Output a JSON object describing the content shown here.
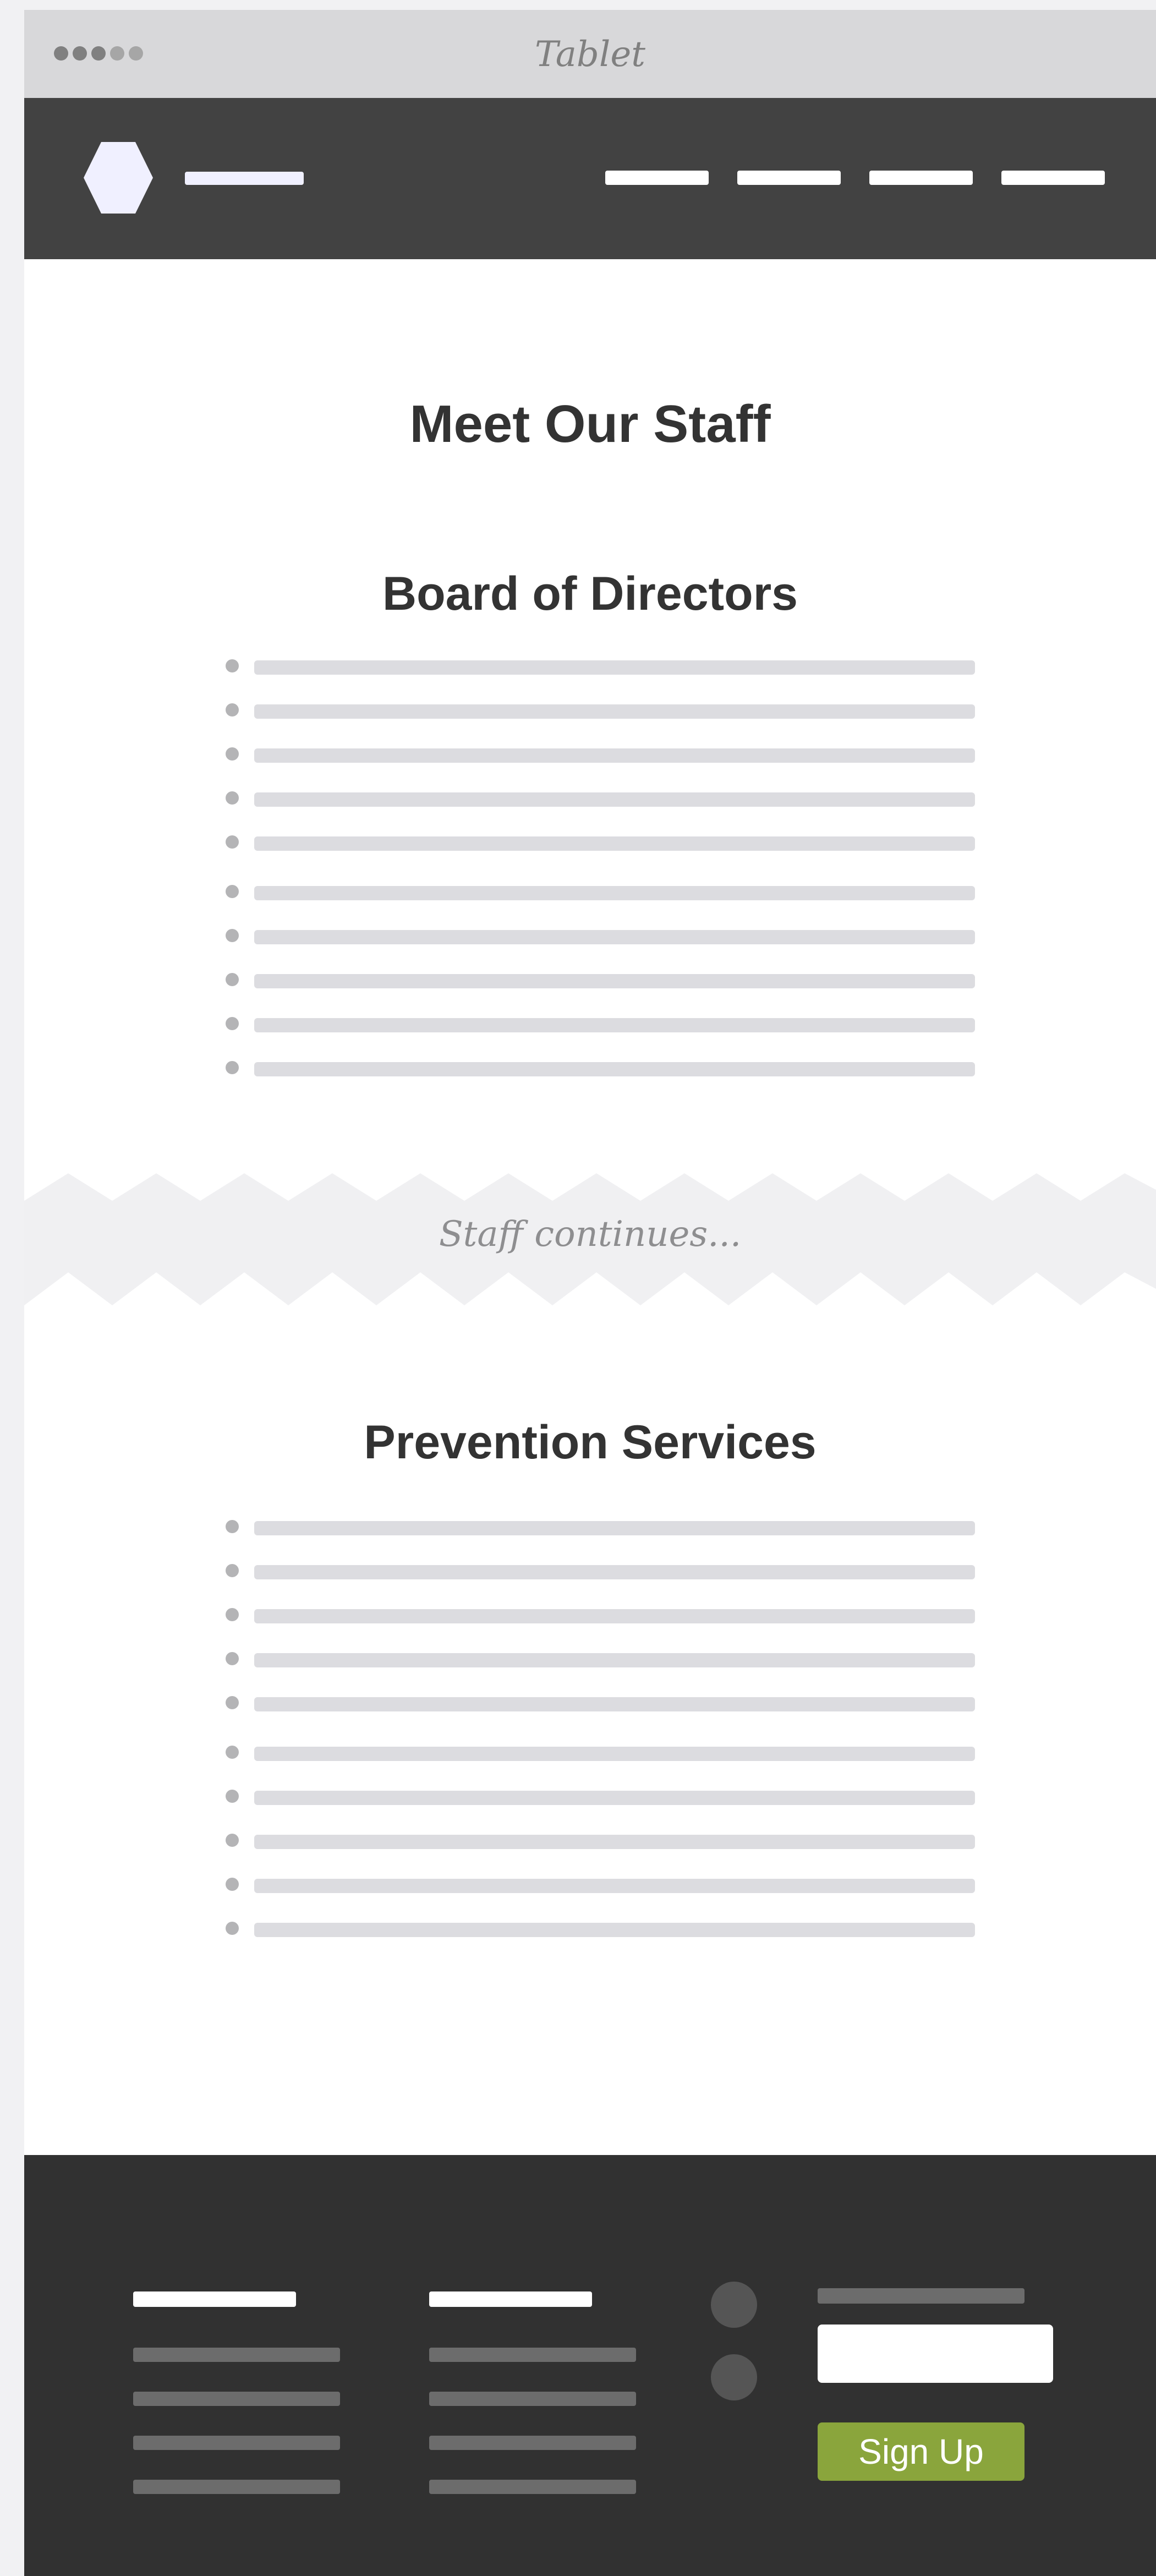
{
  "window": {
    "title": "Tablet",
    "signal_dots": [
      "#808080",
      "#808080",
      "#808080",
      "#a6a6a6",
      "#a6a6a6"
    ]
  },
  "nav": {
    "logo_icon": "hexagon-logo-icon",
    "items_count_shown": 4
  },
  "main": {
    "page_title": "Meet Our Staff",
    "sections": [
      {
        "title": "Board of Directors",
        "placeholder_rows": 10
      },
      {
        "title": "Prevention Services",
        "placeholder_rows": 10
      }
    ],
    "break_label": "Staff continues..."
  },
  "footer": {
    "signup_label": "Sign Up",
    "email_placeholder": "",
    "social_icons": [
      "social-icon",
      "social-icon"
    ]
  },
  "colors": {
    "nav_bg": "#424242",
    "footer_bg": "#313131",
    "accent_button": "#8aa53c",
    "placeholder_line": "#dcdce0",
    "break_band": "#f0f0f2"
  }
}
